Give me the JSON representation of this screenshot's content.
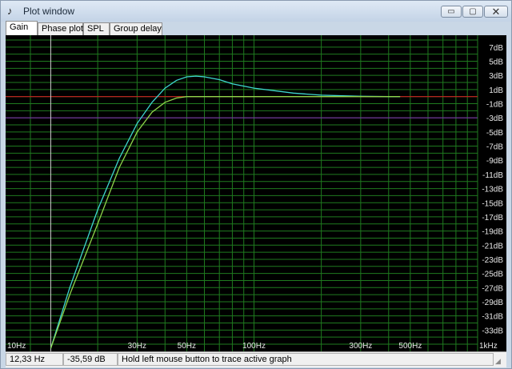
{
  "window": {
    "title": "Plot window",
    "minimize": "▭",
    "maximize": "▢",
    "close": "✕"
  },
  "tabs": [
    {
      "label": "Gain",
      "active": true
    },
    {
      "label": "Phase plot",
      "active": false
    },
    {
      "label": "SPL",
      "active": false
    },
    {
      "label": "Group delay",
      "active": false
    }
  ],
  "status": {
    "frequency": "12,33 Hz",
    "gain": "-35,59 dB",
    "hint": "Hold left mouse button to trace active graph"
  },
  "chart_data": {
    "type": "line",
    "xscale": "log",
    "xlim": [
      10,
      1000
    ],
    "ylim": [
      -35,
      8
    ],
    "x_ticks": [
      {
        "value": 10,
        "label": "10Hz"
      },
      {
        "value": 30,
        "label": "30Hz"
      },
      {
        "value": 50,
        "label": "50Hz"
      },
      {
        "value": 100,
        "label": "100Hz"
      },
      {
        "value": 300,
        "label": "300Hz"
      },
      {
        "value": 500,
        "label": "500Hz"
      },
      {
        "value": 1000,
        "label": "1kHz"
      }
    ],
    "y_ticks": [
      "7dB",
      "5dB",
      "3dB",
      "1dB",
      "-1dB",
      "-3dB",
      "-5dB",
      "-7dB",
      "-9dB",
      "-11dB",
      "-13dB",
      "-15dB",
      "-17dB",
      "-19dB",
      "-21dB",
      "-23dB",
      "-25dB",
      "-27dB",
      "-29dB",
      "-31dB",
      "-33dB"
    ],
    "y_tick_values": [
      7,
      5,
      3,
      1,
      -1,
      -3,
      -5,
      -7,
      -9,
      -11,
      -13,
      -15,
      -17,
      -19,
      -21,
      -23,
      -25,
      -27,
      -29,
      -31,
      -33
    ],
    "reference_lines": [
      {
        "value": 0,
        "color": "#cc2020"
      },
      {
        "value": -3,
        "color": "#7a2fa8"
      }
    ],
    "cursor_x": 12.33,
    "series": [
      {
        "color": "#3fd6d0",
        "x": [
          12.33,
          15,
          20,
          25,
          30,
          35,
          40,
          45,
          50,
          55,
          60,
          70,
          80,
          100,
          150,
          200,
          300,
          400,
          450
        ],
        "y": [
          -35.6,
          -27,
          -16,
          -8.7,
          -3.8,
          -0.8,
          1.2,
          2.3,
          2.8,
          2.9,
          2.8,
          2.4,
          1.8,
          1.2,
          0.5,
          0.2,
          0.05,
          0,
          0
        ]
      },
      {
        "color": "#8fd44a",
        "x": [
          12.33,
          15,
          20,
          25,
          30,
          35,
          40,
          45,
          50,
          60,
          80,
          100,
          200,
          300,
          450
        ],
        "y": [
          -35.6,
          -28,
          -18,
          -10,
          -5,
          -2.2,
          -0.8,
          -0.2,
          0,
          0,
          0,
          0,
          0,
          0,
          0
        ]
      }
    ]
  }
}
